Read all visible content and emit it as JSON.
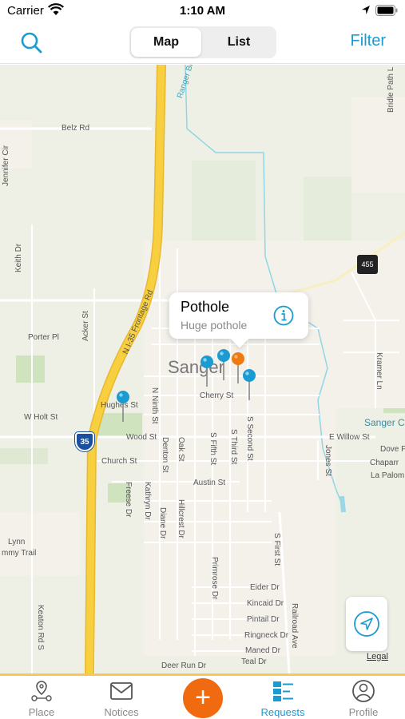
{
  "status_bar": {
    "carrier": "Carrier",
    "time": "1:10 AM"
  },
  "nav": {
    "segments": {
      "map": "Map",
      "list": "List"
    },
    "selected_segment": "Map",
    "filter_label": "Filter",
    "icons": {
      "search": "search-icon"
    }
  },
  "map": {
    "labels": {
      "belz_rd": "Belz Rd",
      "ranger_branch": "Ranger Branch",
      "bridle_path": "Bridle Path L",
      "jennifer_cir": "Jennifer Cir",
      "keith_dr": "Keith Dr",
      "porter_pl": "Porter Pl",
      "acker_st": "Acker St",
      "frontage_rd": "N I-35 Frontage Rd",
      "n_ninth_st": "N Ninth St",
      "sanger": "Sanger",
      "hughes_st": "Hughes St",
      "w_holt_st": "W Holt St",
      "wood_st": "Wood St",
      "cherry_st": "Cherry St",
      "church_st": "Church St",
      "austin_st": "Austin St",
      "s_fifth_st": "S Fifth St",
      "s_third_st": "S Third St",
      "s_second_st": "S Second St",
      "e_willow_st": "E Willow St",
      "jones_st": "Jones St",
      "denton_st": "Denton St",
      "oak_st": "Oak St",
      "freese_dr": "Freese Dr",
      "kathryn_dr": "Kathryn Dr",
      "diane_dr": "Diane Dr",
      "hillcrest_dr": "Hillcrest Dr",
      "s_first_st": "S First St",
      "primrose_dr": "Primrose Dr",
      "eider_dr": "Eider Dr",
      "kincaid_dr": "Kincaid Dr",
      "pintail_dr": "Pintail Dr",
      "ringneck_dr": "Ringneck Dr",
      "maned_dr": "Maned Dr",
      "teal_dr": "Teal Dr",
      "deer_run_dr": "Deer Run Dr",
      "railroad_ave": "Railroad Ave",
      "keaton_rd_s": "Keaton Rd S",
      "lynn": "Lynn",
      "tommy_trail": "mmy Trail",
      "kramer_ln": "Kramer Ln",
      "sanger_c": "Sanger C",
      "dove_p": "Dove P",
      "chaparral": "Chaparr",
      "la_paloma": "La Palom",
      "interstate_shield": "35",
      "state_shield": "455",
      "legal": "Legal"
    },
    "pin_colors": {
      "blue": "#1a9bd1",
      "orange": "#f07a10"
    }
  },
  "callout": {
    "title": "Pothole",
    "subtitle": "Huge pothole"
  },
  "tabs": [
    {
      "label": "Place",
      "icon": "place-icon"
    },
    {
      "label": "Notices",
      "icon": "mail-icon"
    },
    {
      "label": "",
      "icon": "plus-icon"
    },
    {
      "label": "Requests",
      "icon": "list-icon"
    },
    {
      "label": "Profile",
      "icon": "person-icon"
    }
  ],
  "selected_tab": "Requests",
  "colors": {
    "accent": "#1a9bd1",
    "fab": "#f06a10",
    "highway": "#f7cf3f",
    "tab_border": "#f5c85a"
  }
}
